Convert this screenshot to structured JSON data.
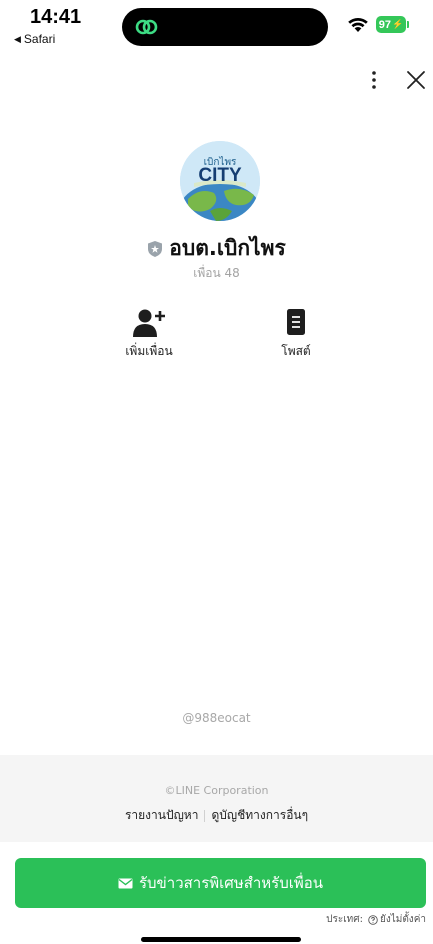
{
  "status_bar": {
    "time": "14:41",
    "back_app": "Safari",
    "battery": "97"
  },
  "profile": {
    "avatar_line1": "เบิกไพร",
    "avatar_line2": "CITY",
    "name": "อบต.เบิกไพร",
    "friends_count": "เพื่อน 48"
  },
  "actions": {
    "add_friend": "เพิ่มเพื่อน",
    "posts": "โพสต์"
  },
  "line_id": "@988eocat",
  "footer": {
    "copyright": "©LINE Corporation",
    "report": "รายงานปัญหา",
    "other_accounts": "ดูบัญชีทางการอื่นๆ"
  },
  "cta": {
    "label": "รับข่าวสารพิเศษสำหรับเพื่อน"
  },
  "country": {
    "label": "ประเทศ:",
    "value": "ยังไม่ตั้งค่า"
  },
  "colors": {
    "line_green": "#2bc058",
    "battery_green": "#34c759"
  }
}
